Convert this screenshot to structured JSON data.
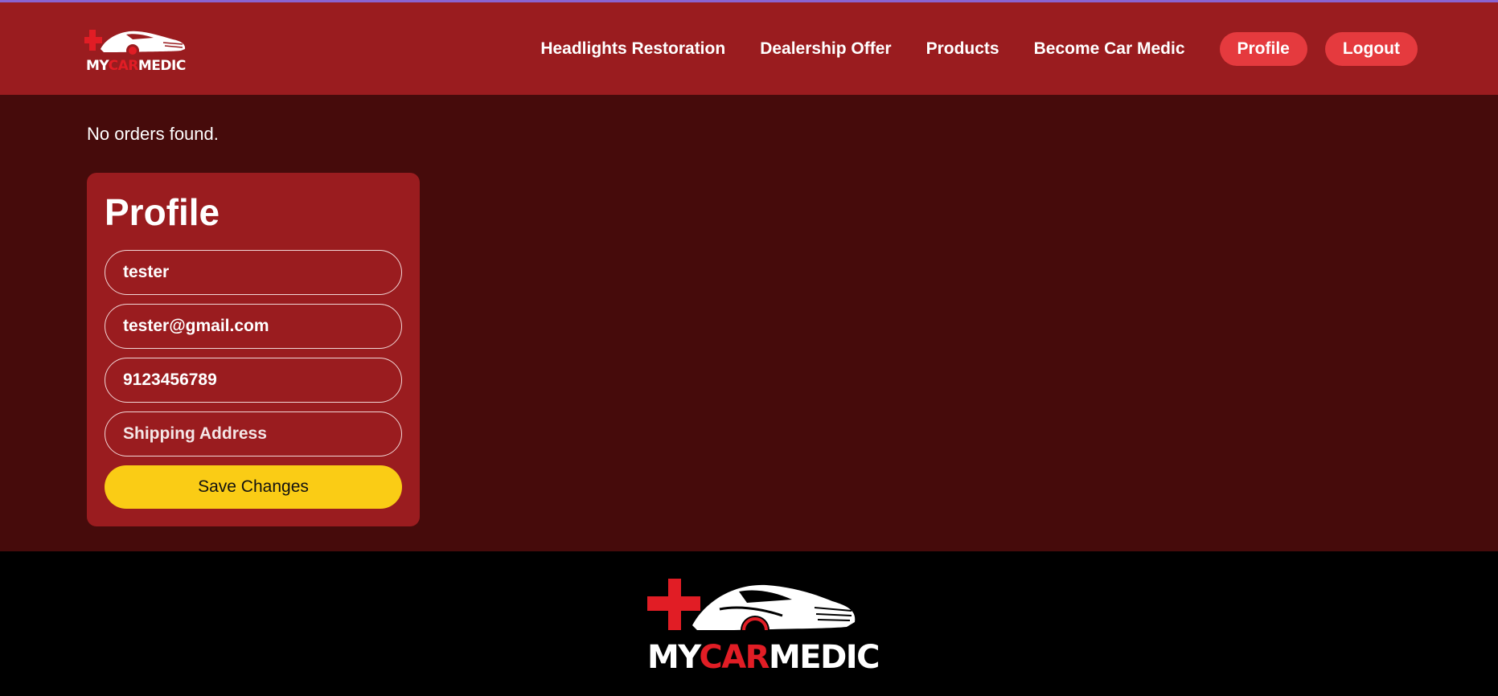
{
  "brand": {
    "name_parts": [
      "MY",
      "CAR",
      "MEDIC"
    ],
    "colors": {
      "white": "#ffffff",
      "red": "#e11d25"
    },
    "icon": "car-cross-logo-icon"
  },
  "nav": {
    "items": [
      "Headlights Restoration",
      "Dealership Offer",
      "Products",
      "Become Car Medic"
    ],
    "profile_label": "Profile",
    "logout_label": "Logout"
  },
  "orders": {
    "empty_message": "No orders found."
  },
  "profile": {
    "title": "Profile",
    "name_value": "tester",
    "email_value": "tester@gmail.com",
    "phone_value": "9123456789",
    "address_placeholder": "Shipping Address",
    "save_label": "Save Changes"
  },
  "colors": {
    "header_bg": "#9a1c1f",
    "page_bg": "#460b0b",
    "accent_pill": "#e53a3e",
    "save_button": "#facc15",
    "footer_bg": "#000000"
  }
}
